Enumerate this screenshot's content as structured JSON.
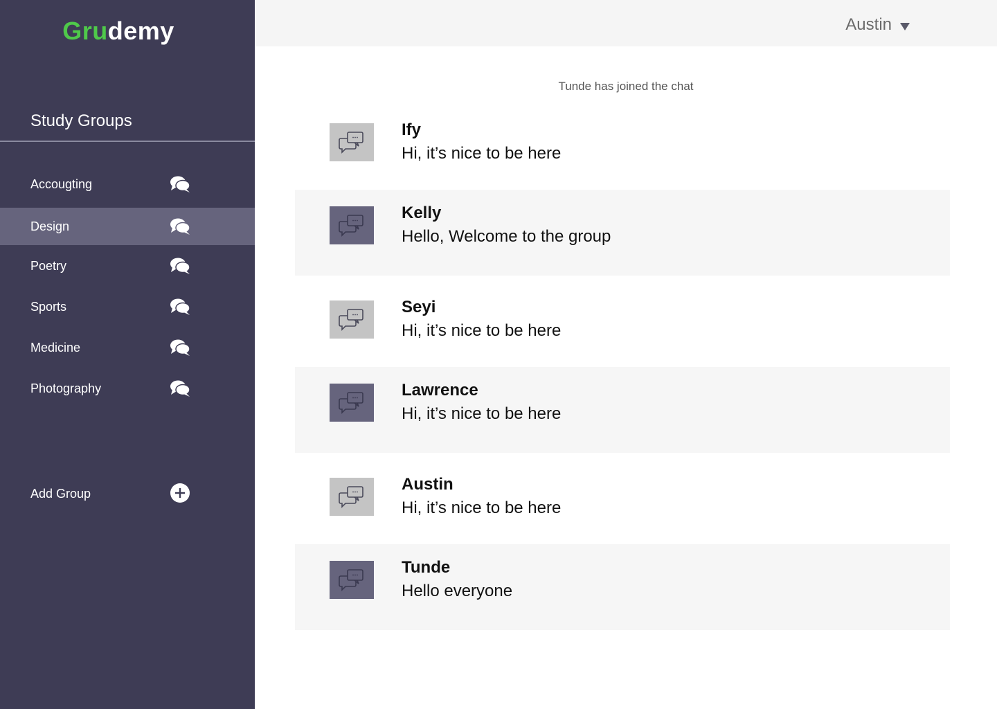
{
  "app": {
    "logo_part1": "Gru",
    "logo_part2": "demy"
  },
  "sidebar": {
    "section_title": "Study Groups",
    "groups": [
      {
        "label": "Accougting",
        "active": false
      },
      {
        "label": "Design",
        "active": true
      },
      {
        "label": "Poetry",
        "active": false
      },
      {
        "label": "Sports",
        "active": false
      },
      {
        "label": "Medicine",
        "active": false
      },
      {
        "label": "Photography",
        "active": false
      }
    ],
    "group_icon": "chat-bubbles-icon",
    "add_group_label": "Add Group",
    "add_group_icon": "plus-circle-icon"
  },
  "header": {
    "user_name": "Austin",
    "user_menu_icon": "caret-down-icon"
  },
  "chat": {
    "system_message": "Tunde has joined the chat",
    "messages": [
      {
        "author": "Ify",
        "text": "Hi, it’s nice to be  here"
      },
      {
        "author": "Kelly",
        "text": "Hello, Welcome to the group"
      },
      {
        "author": "Seyi",
        "text": "Hi, it’s nice to be  here"
      },
      {
        "author": "Lawrence",
        "text": "Hi, it’s nice to be  here"
      },
      {
        "author": "Austin",
        "text": "Hi, it’s nice to be  here"
      },
      {
        "author": "Tunde",
        "text": "Hello everyone"
      }
    ],
    "avatar_icon": "chat-bubbles-icon"
  },
  "colors": {
    "sidebar_bg": "#3e3c55",
    "sidebar_active": "#66647d",
    "brand_green": "#4fc94a",
    "avatar_light": "#c4c4c4",
    "avatar_dark": "#66647d",
    "row_alt_bg": "#f6f6f6",
    "header_bg": "#f5f5f5"
  }
}
